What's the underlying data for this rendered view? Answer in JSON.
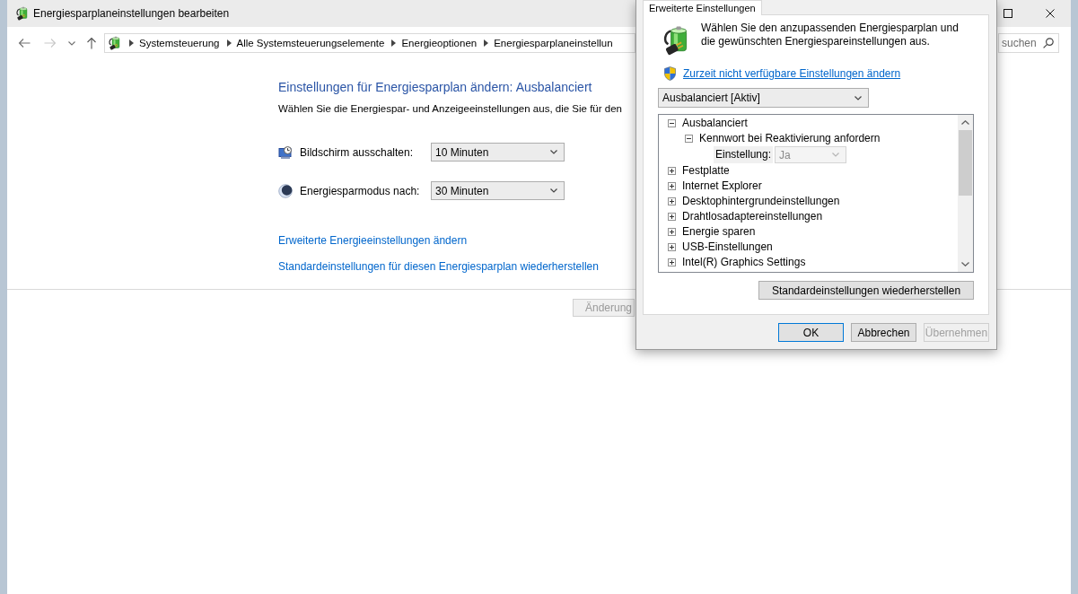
{
  "window": {
    "title": "Energiesparplaneinstellungen bearbeiten"
  },
  "navigation": {
    "back": {
      "disabled": false
    },
    "forward": {
      "disabled": true
    }
  },
  "address_bar": {
    "breadcrumbs": [
      "Systemsteuerung",
      "Alle Systemsteuerungselemente",
      "Energieoptionen",
      "Energiesparplaneinstellun"
    ]
  },
  "search": {
    "placeholder": "suchen"
  },
  "plan_settings": {
    "heading": "Einstellungen für Energiesparplan ändern: Ausbalanciert",
    "description": "Wählen Sie die Energiespar- und Anzeigeeinstellungen aus, die Sie für den",
    "settings": [
      {
        "kind": "display",
        "label": "Bildschirm ausschalten:",
        "value": "10 Minuten"
      },
      {
        "kind": "sleep",
        "label": "Energiesparmodus nach:",
        "value": "30 Minuten"
      }
    ],
    "links": [
      "Erweiterte Energieeinstellungen ändern",
      "Standardeinstellungen für diesen Energiesparplan wiederherstellen"
    ],
    "save_button": {
      "label": "Änderung",
      "disabled": true
    }
  },
  "dialog": {
    "tabs": [
      {
        "label": "Erweiterte Einstellungen",
        "selected": true
      }
    ],
    "intro": "Wählen Sie den anzupassenden Energiesparplan und die gewünschten Energiespareinstellungen aus.",
    "admin_link": "Zurzeit nicht verfügbare Einstellungen ändern",
    "plan_select": {
      "value": "Ausbalanciert [Aktiv]"
    },
    "tree": [
      {
        "kind": "group",
        "label": "Ausbalanciert",
        "expanded": true,
        "children": [
          {
            "kind": "group",
            "label": "Kennwort bei Reaktivierung anfordern",
            "expanded": true,
            "children": [
              {
                "kind": "setting",
                "label": "Einstellung:",
                "value": "Ja",
                "disabled": true
              }
            ]
          }
        ]
      },
      {
        "kind": "group",
        "label": "Festplatte",
        "expanded": false
      },
      {
        "kind": "group",
        "label": "Internet Explorer",
        "expanded": false
      },
      {
        "kind": "group",
        "label": "Desktophintergrundeinstellungen",
        "expanded": false
      },
      {
        "kind": "group",
        "label": "Drahtlosadaptereinstellungen",
        "expanded": false
      },
      {
        "kind": "group",
        "label": "Energie sparen",
        "expanded": false
      },
      {
        "kind": "group",
        "label": "USB-Einstellungen",
        "expanded": false
      },
      {
        "kind": "group",
        "label": "Intel(R) Graphics Settings",
        "expanded": false
      }
    ],
    "restore_button": "Standardeinstellungen wiederherstellen",
    "buttons": [
      {
        "label": "OK",
        "default": true,
        "disabled": false
      },
      {
        "label": "Abbrechen",
        "default": false,
        "disabled": false
      },
      {
        "label": "Übernehmen",
        "default": false,
        "disabled": true
      }
    ]
  }
}
